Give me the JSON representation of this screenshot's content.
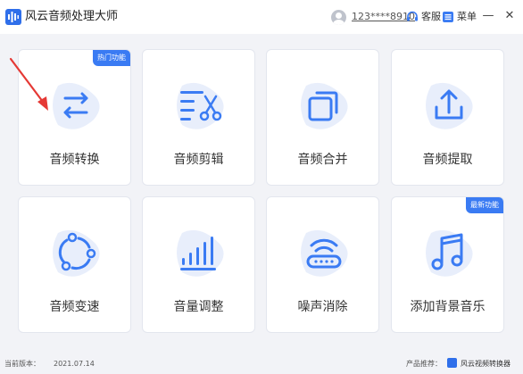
{
  "window": {
    "title": "风云音频处理大师",
    "username": "123****8910",
    "service_label": "客服",
    "menu_label": "菜单",
    "minimize": "—",
    "close": "✕"
  },
  "cards": [
    {
      "label": "音频转换",
      "icon": "convert-icon",
      "badge": "热门功能"
    },
    {
      "label": "音频剪辑",
      "icon": "scissors-icon",
      "badge": ""
    },
    {
      "label": "音频合并",
      "icon": "merge-icon",
      "badge": ""
    },
    {
      "label": "音频提取",
      "icon": "extract-icon",
      "badge": ""
    },
    {
      "label": "音频变速",
      "icon": "speed-icon",
      "badge": ""
    },
    {
      "label": "音量调整",
      "icon": "volume-bars-icon",
      "badge": ""
    },
    {
      "label": "噪声消除",
      "icon": "denoise-icon",
      "badge": ""
    },
    {
      "label": "添加背景音乐",
      "icon": "music-note-icon",
      "badge": "最新功能"
    }
  ],
  "footer": {
    "version_label": "当前版本：",
    "version_value": "2021.07.14",
    "promo_label": "产品推荐：",
    "promo_link": "风云视频转换器"
  },
  "colors": {
    "accent": "#3a7bf3",
    "icon_bg": "#e8eefb",
    "annotation_arrow": "#e53935"
  }
}
